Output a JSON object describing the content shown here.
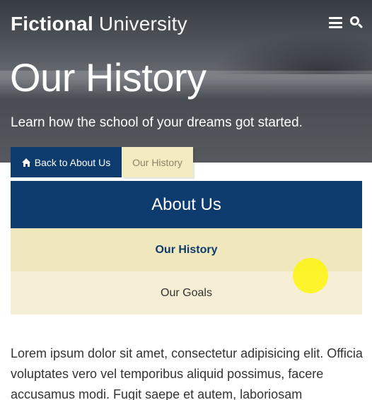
{
  "header": {
    "brand_strong": "Fictional",
    "brand_light": "University",
    "menu_icon": "menu-icon",
    "search_icon": "search-icon"
  },
  "banner": {
    "title": "Our History",
    "subtitle": "Learn how the school of your dreams got started."
  },
  "breadcrumb": {
    "home_label": "Back to About Us",
    "home_icon": "home-icon",
    "current_label": "Our History"
  },
  "subnav": {
    "title": "About Us",
    "items": [
      {
        "label": "Our History",
        "active": true
      },
      {
        "label": "Our Goals",
        "active": false
      }
    ]
  },
  "content": {
    "paragraph": "Lorem ipsum dolor sit amet, consectetur adipisicing elit. Officia voluptates vero vel temporibus aliquid possimus, facere accusamus modi. Fugit saepe et autem, laboriosam"
  },
  "colors": {
    "primary_blue": "#0d3b6e",
    "beige_active": "#f0e8bc",
    "beige_light": "#f6efd6"
  }
}
